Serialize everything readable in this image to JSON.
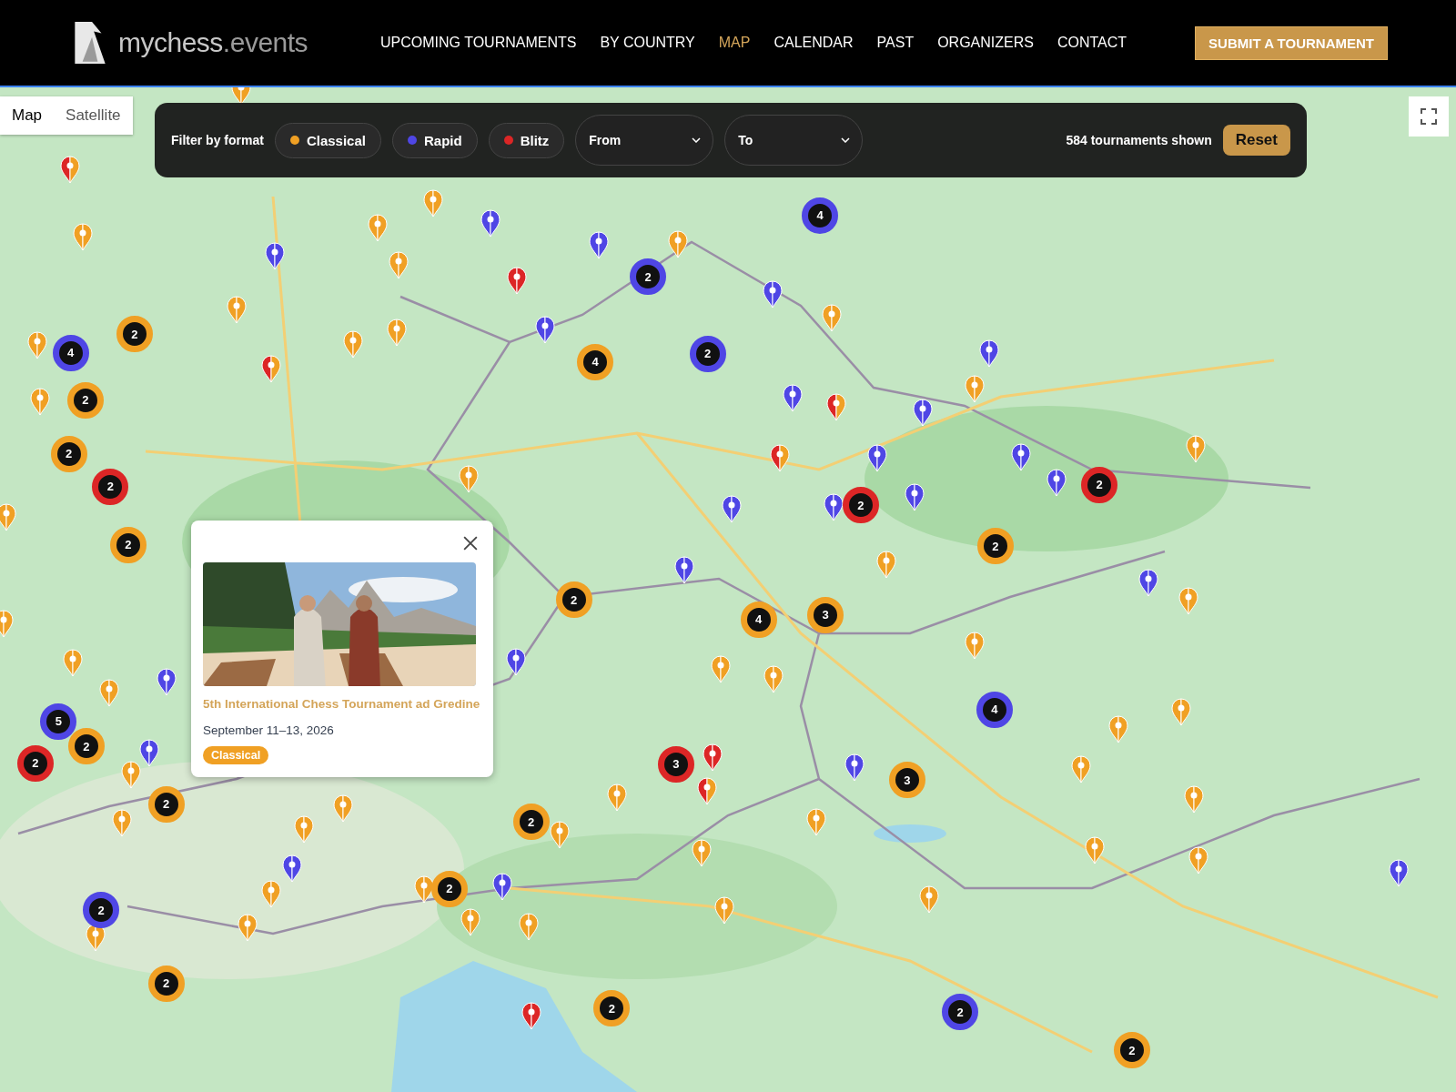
{
  "header": {
    "logo": {
      "name": "mychess",
      "suffix": ".events"
    },
    "nav": [
      {
        "label": "UPCOMING TOURNAMENTS",
        "selected": false
      },
      {
        "label": "BY COUNTRY",
        "selected": false
      },
      {
        "label": "MAP",
        "selected": true
      },
      {
        "label": "CALENDAR",
        "selected": false
      },
      {
        "label": "PAST",
        "selected": false
      },
      {
        "label": "ORGANIZERS",
        "selected": false
      },
      {
        "label": "CONTACT",
        "selected": false
      }
    ],
    "submit": "SUBMIT A TOURNAMENT"
  },
  "map_type": [
    {
      "label": "Map",
      "selected": true
    },
    {
      "label": "Satellite",
      "selected": false
    }
  ],
  "filter": {
    "label": "Filter by format",
    "formats": [
      {
        "label": "Classical",
        "color": "#f0a024"
      },
      {
        "label": "Rapid",
        "color": "#4f46e5"
      },
      {
        "label": "Blitz",
        "color": "#dc2626"
      }
    ],
    "from": {
      "placeholder": "From"
    },
    "to": {
      "placeholder": "To"
    },
    "count": "584 tournaments shown",
    "reset": "Reset"
  },
  "clusters": [
    {
      "count": "4",
      "color": "#4f46e5"
    },
    {
      "count": "2",
      "color": "#4f46e5"
    },
    {
      "count": "2",
      "color": "#f0a024"
    },
    {
      "count": "4",
      "color": "#4f46e5"
    },
    {
      "count": "2",
      "color": "#f0a024"
    },
    {
      "count": "2",
      "color": "#f0a024"
    },
    {
      "count": "2",
      "color": "#dc2626"
    },
    {
      "count": "2",
      "color": "#f0a024"
    },
    {
      "count": "4",
      "color": "#f0a024"
    },
    {
      "count": "2",
      "color": "#4f46e5"
    },
    {
      "count": "2",
      "color": "#dc2626"
    },
    {
      "count": "2",
      "color": "#dc2626"
    },
    {
      "count": "2",
      "color": "#f0a024"
    },
    {
      "count": "2",
      "color": "#f0a024"
    },
    {
      "count": "4",
      "color": "#f0a024"
    },
    {
      "count": "3",
      "color": "#f0a024"
    },
    {
      "count": "4",
      "color": "#4f46e5"
    },
    {
      "count": "5",
      "color": "#4f46e5"
    },
    {
      "count": "2",
      "color": "#f0a024"
    },
    {
      "count": "2",
      "color": "#dc2626"
    },
    {
      "count": "2",
      "color": "#f0a024"
    },
    {
      "count": "3",
      "color": "#dc2626"
    },
    {
      "count": "3",
      "color": "#f0a024"
    },
    {
      "count": "2",
      "color": "#f0a024"
    },
    {
      "count": "2",
      "color": "#f0a024"
    },
    {
      "count": "2",
      "color": "#4f46e5"
    },
    {
      "count": "2",
      "color": "#f0a024"
    },
    {
      "count": "2",
      "color": "#f0a024"
    },
    {
      "count": "2",
      "color": "#4f46e5"
    },
    {
      "count": "2",
      "color": "#f0a024"
    }
  ],
  "pins": [
    {
      "kind": "mixed"
    },
    {
      "kind": "classical"
    },
    {
      "kind": "rapid"
    },
    {
      "kind": "classical"
    },
    {
      "kind": "classical"
    },
    {
      "kind": "rapid"
    },
    {
      "kind": "classical"
    },
    {
      "kind": "blitz"
    },
    {
      "kind": "rapid"
    },
    {
      "kind": "classical"
    },
    {
      "kind": "classical"
    },
    {
      "kind": "classical"
    },
    {
      "kind": "classical"
    },
    {
      "kind": "classical"
    },
    {
      "kind": "classical"
    },
    {
      "kind": "mixed"
    },
    {
      "kind": "rapid"
    },
    {
      "kind": "rapid"
    },
    {
      "kind": "classical"
    },
    {
      "kind": "rapid"
    },
    {
      "kind": "classical"
    },
    {
      "kind": "rapid"
    },
    {
      "kind": "rapid"
    },
    {
      "kind": "mixed"
    },
    {
      "kind": "mixed"
    },
    {
      "kind": "rapid"
    },
    {
      "kind": "rapid"
    },
    {
      "kind": "rapid"
    },
    {
      "kind": "rapid"
    },
    {
      "kind": "rapid"
    },
    {
      "kind": "rapid"
    },
    {
      "kind": "classical"
    },
    {
      "kind": "classical"
    },
    {
      "kind": "classical"
    },
    {
      "kind": "rapid"
    },
    {
      "kind": "rapid"
    },
    {
      "kind": "classical"
    },
    {
      "kind": "classical"
    },
    {
      "kind": "rapid"
    },
    {
      "kind": "classical"
    },
    {
      "kind": "classical"
    },
    {
      "kind": "classical"
    },
    {
      "kind": "classical"
    },
    {
      "kind": "rapid"
    },
    {
      "kind": "rapid"
    },
    {
      "kind": "classical"
    },
    {
      "kind": "classical"
    },
    {
      "kind": "classical"
    },
    {
      "kind": "classical"
    },
    {
      "kind": "rapid"
    },
    {
      "kind": "classical"
    },
    {
      "kind": "classical"
    },
    {
      "kind": "blitz"
    },
    {
      "kind": "mixed"
    },
    {
      "kind": "classical"
    },
    {
      "kind": "classical"
    },
    {
      "kind": "rapid"
    },
    {
      "kind": "classical"
    },
    {
      "kind": "classical"
    },
    {
      "kind": "classical"
    },
    {
      "kind": "classical"
    },
    {
      "kind": "classical"
    },
    {
      "kind": "classical"
    },
    {
      "kind": "rapid"
    },
    {
      "kind": "classical"
    },
    {
      "kind": "classical"
    },
    {
      "kind": "classical"
    },
    {
      "kind": "classical"
    },
    {
      "kind": "classical"
    },
    {
      "kind": "classical"
    },
    {
      "kind": "classical"
    },
    {
      "kind": "rapid"
    },
    {
      "kind": "blitz"
    },
    {
      "kind": "classical"
    },
    {
      "kind": "classical"
    },
    {
      "kind": "classical"
    },
    {
      "kind": "classical"
    }
  ],
  "popup": {
    "title": "5th International Chess Tournament ad Gredine",
    "date": "September 11–13, 2026",
    "tag": "Classical"
  }
}
